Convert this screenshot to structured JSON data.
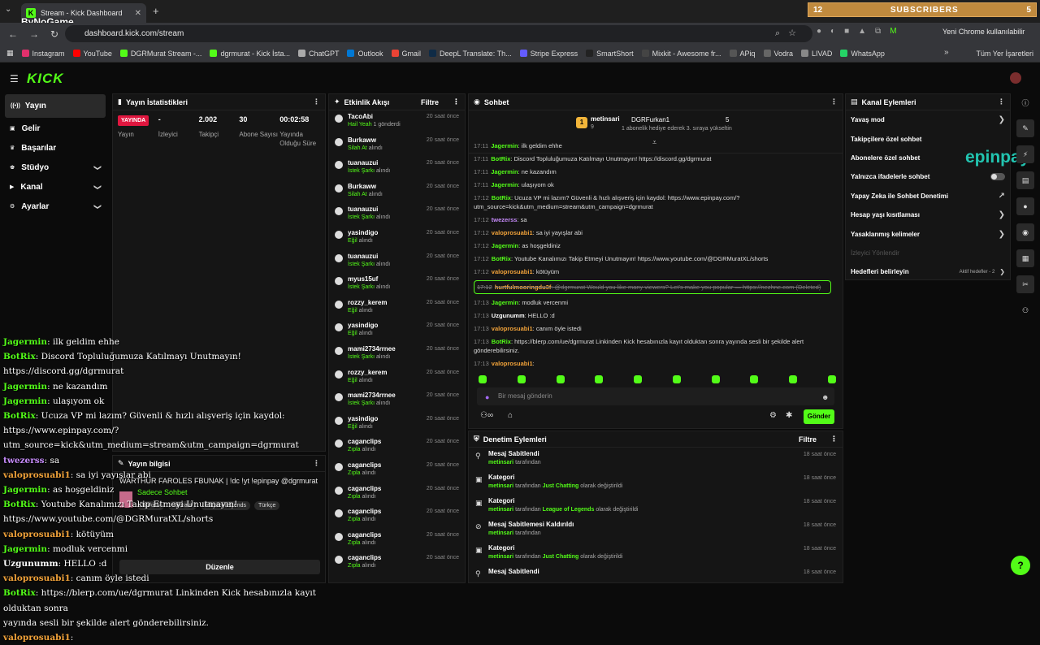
{
  "browser": {
    "tab_title": "Stream - Kick Dashboard",
    "url": "dashboard.kick.com/stream",
    "profile_label": "Yeni Chrome kullanılabilir",
    "watermark": "ByNoGame",
    "subs_left": "12",
    "subs_label": "SUBSCRIBERS",
    "subs_right": "5",
    "bookmarks": [
      {
        "label": "Instagram",
        "color": "#e1306c"
      },
      {
        "label": "YouTube",
        "color": "#ff0000"
      },
      {
        "label": "DGRMurat Stream -...",
        "color": "#53fc18"
      },
      {
        "label": "dgrmurat - Kick İsta...",
        "color": "#53fc18"
      },
      {
        "label": "ChatGPT",
        "color": "#aaaaaa"
      },
      {
        "label": "Outlook",
        "color": "#0078d4"
      },
      {
        "label": "Gmail",
        "color": "#ea4335"
      },
      {
        "label": "DeepL Translate: Th...",
        "color": "#0f2b46"
      },
      {
        "label": "Stripe Express",
        "color": "#635bff"
      },
      {
        "label": "SmartShort",
        "color": "#222222"
      },
      {
        "label": "Mixkit - Awesome fr...",
        "color": "#444444"
      },
      {
        "label": "APiq",
        "color": "#555555"
      },
      {
        "label": "Vodra",
        "color": "#666666"
      },
      {
        "label": "LIVAD",
        "color": "#888888"
      },
      {
        "label": "WhatsApp",
        "color": "#25d366"
      }
    ],
    "bookmarks_right": "Tüm Yer İşaretleri"
  },
  "nav": {
    "items": [
      {
        "label": "Yayın",
        "icon": "broadcast-icon",
        "chev": ""
      },
      {
        "label": "Gelir",
        "icon": "wallet-icon",
        "chev": ""
      },
      {
        "label": "Başarılar",
        "icon": "trophy-icon",
        "chev": ""
      },
      {
        "label": "Stüdyo",
        "icon": "studio-icon",
        "chev": "❯"
      },
      {
        "label": "Kanal",
        "icon": "channel-icon",
        "chev": "❯"
      },
      {
        "label": "Ayarlar",
        "icon": "gear-icon",
        "chev": "❯"
      }
    ]
  },
  "stats": {
    "title": "Yayın İstatistikleri",
    "live_badge": "YAYINDA",
    "items": [
      {
        "value": "-",
        "label": "İzleyici"
      },
      {
        "value": "2.002",
        "label": "Takipçi"
      },
      {
        "value": "30",
        "label": "Abone Sayısı"
      },
      {
        "value": "00:02:58",
        "label": "Yayında Olduğu Süre"
      }
    ],
    "first_label": "Yayın"
  },
  "info": {
    "title": "Yayın bilgisi",
    "stream_title": "WARTHUR FAROLES FBUNAK | !dc !yt !epinpay @dgrmurat",
    "category": "Sadece Sohbet",
    "tags": [
      "Turkish",
      "valorant",
      "leagueoflegends",
      "Türkçe"
    ],
    "edit": "Düzenle"
  },
  "activity": {
    "title": "Etkinlik Akışı",
    "filter": "Filtre",
    "items": [
      {
        "name": "TacoAbi",
        "line": "Hail Yeah",
        "extra": "1 gönderdi",
        "time": "20 saat önce"
      },
      {
        "name": "Burkaww",
        "line": "Silah At",
        "extra": "alındı",
        "time": "20 saat önce"
      },
      {
        "name": "tuanauzui",
        "line": "İstek Şarkı",
        "extra": "alındı",
        "time": "20 saat önce"
      },
      {
        "name": "Burkaww",
        "line": "Silah At",
        "extra": "alındı",
        "time": "20 saat önce"
      },
      {
        "name": "tuanauzui",
        "line": "İstek Şarkı",
        "extra": "alındı",
        "time": "20 saat önce"
      },
      {
        "name": "yasindigo",
        "line": "Eğil",
        "extra": "alındı",
        "time": "20 saat önce"
      },
      {
        "name": "tuanauzui",
        "line": "İstek Şarkı",
        "extra": "alındı",
        "time": "20 saat önce"
      },
      {
        "name": "myus15uf",
        "line": "İstek Şarkı",
        "extra": "alındı",
        "time": "20 saat önce"
      },
      {
        "name": "rozzy_kerem",
        "line": "Eğil",
        "extra": "alındı",
        "time": "20 saat önce"
      },
      {
        "name": "yasindigo",
        "line": "Eğil",
        "extra": "alındı",
        "time": "20 saat önce"
      },
      {
        "name": "mami2734rrnee",
        "line": "İstek Şarkı",
        "extra": "alındı",
        "time": "20 saat önce"
      },
      {
        "name": "rozzy_kerem",
        "line": "Eğil",
        "extra": "alındı",
        "time": "20 saat önce"
      },
      {
        "name": "mami2734rrnee",
        "line": "İstek Şarkı",
        "extra": "alındı",
        "time": "20 saat önce"
      },
      {
        "name": "yasindigo",
        "line": "Eğil",
        "extra": "alındı",
        "time": "20 saat önce"
      },
      {
        "name": "caganclips",
        "line": "Zıpla",
        "extra": "alındı",
        "time": "20 saat önce"
      },
      {
        "name": "caganclips",
        "line": "Zıpla",
        "extra": "alındı",
        "time": "20 saat önce"
      },
      {
        "name": "caganclips",
        "line": "Zıpla",
        "extra": "alındı",
        "time": "20 saat önce"
      },
      {
        "name": "caganclips",
        "line": "Zıpla",
        "extra": "alındı",
        "time": "20 saat önce"
      },
      {
        "name": "caganclips",
        "line": "Zıpla",
        "extra": "alındı",
        "time": "20 saat önce"
      },
      {
        "name": "caganclips",
        "line": "Zıpla",
        "extra": "alındı",
        "time": "20 saat önce"
      }
    ]
  },
  "chat": {
    "title": "Sohbet",
    "pinned_user": "metinsari",
    "pinned_count": "9",
    "pinned_target": "DGRFurkan1",
    "pinned_target_count": "5",
    "pinned_text": "1 abonelik hediye ederek 3. sıraya yükseltin",
    "placeholder": "Bir mesaj gönderin",
    "send": "Gönder",
    "messages": [
      {
        "ts": "17:11",
        "user": "Jagermin",
        "color": "#53fc18",
        "text": "ilk geldim ehhe",
        "del": false
      },
      {
        "ts": "17:11",
        "user": "BotRix",
        "color": "#53fc18",
        "text": "Discord Topluluğumuza Katılmayı Unutmayın! https://discord.gg/dgrmurat",
        "del": false
      },
      {
        "ts": "17:11",
        "user": "Jagermin",
        "color": "#53fc18",
        "text": "ne kazandım",
        "del": false
      },
      {
        "ts": "17:11",
        "user": "Jagermin",
        "color": "#53fc18",
        "text": "ulaşıyom ok",
        "del": false
      },
      {
        "ts": "17:12",
        "user": "BotRix",
        "color": "#53fc18",
        "text": "Ucuza VP mi lazım? Güvenli & hızlı alışveriş için kaydol: https://www.epinpay.com/?utm_source=kick&utm_medium=stream&utm_campaign=dgrmurat",
        "del": false
      },
      {
        "ts": "17:12",
        "user": "twezerss",
        "color": "#c58af9",
        "text": "sa",
        "del": false
      },
      {
        "ts": "17:12",
        "user": "valoprosuabi1",
        "color": "#f2a33a",
        "text": "sa iyi yayışlar abi",
        "del": false
      },
      {
        "ts": "17:12",
        "user": "Jagermin",
        "color": "#53fc18",
        "text": "as hoşgeldiniz",
        "del": false
      },
      {
        "ts": "17:12",
        "user": "BotRix",
        "color": "#53fc18",
        "text": "Youtube Kanalımızı Takip Etmeyi Unutmayın! https://www.youtube.com/@DGRMuratXL/shorts",
        "del": false
      },
      {
        "ts": "17:12",
        "user": "valoprosuabi1",
        "color": "#f2a33a",
        "text": "kötüyüm",
        "del": false
      },
      {
        "ts": "17:12",
        "user": "hurtfulmooringdu3f",
        "color": "#f2a33a",
        "text": "@dgrmurat Would you like many viewers? Let's make you popular — https://nezhne.com (Deleted)",
        "del": true
      },
      {
        "ts": "17:13",
        "user": "Jagermin",
        "color": "#53fc18",
        "text": "modluk vercenmi",
        "del": false
      },
      {
        "ts": "17:13",
        "user": "Uzgunumm",
        "color": "#ffffff",
        "text": "HELLO :d",
        "del": false
      },
      {
        "ts": "17:13",
        "user": "valoprosuabi1",
        "color": "#f2a33a",
        "text": "canım öyle istedi",
        "del": false
      },
      {
        "ts": "17:13",
        "user": "BotRix",
        "color": "#53fc18",
        "text": "https://blerp.com/ue/dgrmurat Linkinden Kick hesabınızla kayıt olduktan sonra yayında sesli bir şekilde alert gönderebilirsiniz.",
        "del": false
      },
      {
        "ts": "17:13",
        "user": "valoprosuabi1",
        "color": "#f2a33a",
        "text": "",
        "del": false
      }
    ]
  },
  "mod": {
    "title": "Denetim Eylemleri",
    "filter": "Filtre",
    "items": [
      {
        "title": "Mesaj Sabitlendi",
        "user": "metinsari",
        "desc": "tarafından",
        "extra": "",
        "tail": "",
        "time": "18 saat önce",
        "icon": "pin-icon"
      },
      {
        "title": "Kategori",
        "user": "metinsari",
        "desc": "tarafından",
        "extra": "Just Chatting",
        "tail": "olarak değiştirildi",
        "time": "18 saat önce",
        "icon": "category-icon"
      },
      {
        "title": "Kategori",
        "user": "metinsari",
        "desc": "tarafından",
        "extra": "League of Legends",
        "tail": "olarak değiştirildi",
        "time": "18 saat önce",
        "icon": "category-icon"
      },
      {
        "title": "Mesaj Sabitlemesi Kaldırıldı",
        "user": "metinsari",
        "desc": "tarafından",
        "extra": "",
        "tail": "",
        "time": "18 saat önce",
        "icon": "unpin-icon"
      },
      {
        "title": "Kategori",
        "user": "metinsari",
        "desc": "tarafından",
        "extra": "Just Chatting",
        "tail": "olarak değiştirildi",
        "time": "18 saat önce",
        "icon": "category-icon"
      },
      {
        "title": "Mesaj Sabitlendi",
        "user": "",
        "desc": "",
        "extra": "",
        "tail": "",
        "time": "18 saat önce",
        "icon": "pin-icon"
      }
    ]
  },
  "channel": {
    "title": "Kanal Eylemleri",
    "items": [
      {
        "label": "Yavaş mod",
        "right": "❯",
        "disabled": false
      },
      {
        "label": "Takipçilere özel sohbet",
        "right": "",
        "disabled": false
      },
      {
        "label": "Abonelere özel sohbet",
        "right": "",
        "disabled": false
      },
      {
        "label": "Yalnızca ifadelerle sohbet",
        "right": "toggle",
        "disabled": false
      },
      {
        "label": "Yapay Zeka ile Sohbet Denetimi",
        "right": "↗",
        "disabled": false
      },
      {
        "label": "Hesap yaşı kısıtlaması",
        "right": "❯",
        "disabled": false
      },
      {
        "label": "Yasaklanmış kelimeler",
        "right": "❯",
        "disabled": false
      },
      {
        "label": "İzleyici Yönlendir",
        "right": "",
        "disabled": true
      },
      {
        "label": "Hedefleri belirleyin",
        "right": "❯",
        "disabled": false
      }
    ],
    "goals_badge": "Aktif hedefler - 2",
    "sponsor": "epinpay"
  },
  "overlay": {
    "messages": [
      {
        "user": "Jagermin",
        "color": "#53fc18",
        "text": "ilk geldim ehhe"
      },
      {
        "user": "BotRix",
        "color": "#53fc18",
        "text": "Discord Topluluğumuza Katılmayı Unutmayın! https://discord.gg/dgrmurat"
      },
      {
        "user": "Jagermin",
        "color": "#53fc18",
        "text": "ne kazandım"
      },
      {
        "user": "Jagermin",
        "color": "#53fc18",
        "text": "ulaşıyom ok"
      },
      {
        "user": "BotRix",
        "color": "#53fc18",
        "text": "Ucuza VP mi lazım? Güvenli & hızlı alışveriş için kaydol:"
      },
      {
        "user": "",
        "color": "#ffffff",
        "text": "https://www.epinpay.com/?utm_source=kick&utm_medium=stream&utm_campaign=dgrmurat"
      },
      {
        "user": "twezerss",
        "color": "#c58af9",
        "text": "sa"
      },
      {
        "user": "valoprosuabi1",
        "color": "#f2a33a",
        "text": "sa iyi yayışlar abi"
      },
      {
        "user": "Jagermin",
        "color": "#53fc18",
        "text": "as hoşgeldiniz"
      },
      {
        "user": "BotRix",
        "color": "#53fc18",
        "text": "Youtube Kanalımızı Takip Etmeyi Unutmayın!"
      },
      {
        "user": "",
        "color": "#ffffff",
        "text": "https://www.youtube.com/@DGRMuratXL/shorts"
      },
      {
        "user": "valoprosuabi1",
        "color": "#f2a33a",
        "text": "kötüyüm"
      },
      {
        "user": "Jagermin",
        "color": "#53fc18",
        "text": "modluk vercenmi"
      },
      {
        "user": "Uzgunumm",
        "color": "#ffffff",
        "text": "HELLO :d"
      },
      {
        "user": "valoprosuabi1",
        "color": "#f2a33a",
        "text": "canım öyle istedi"
      },
      {
        "user": "BotRix",
        "color": "#53fc18",
        "text": "https://blerp.com/ue/dgrmurat Linkinden Kick hesabınızla kayıt olduktan sonra"
      },
      {
        "user": "",
        "color": "#ffffff",
        "text": "yayında sesli bir şekilde alert gönderebilirsiniz."
      },
      {
        "user": "valoprosuabi1",
        "color": "#f2a33a",
        "text": ""
      }
    ]
  },
  "logo": "KICK"
}
